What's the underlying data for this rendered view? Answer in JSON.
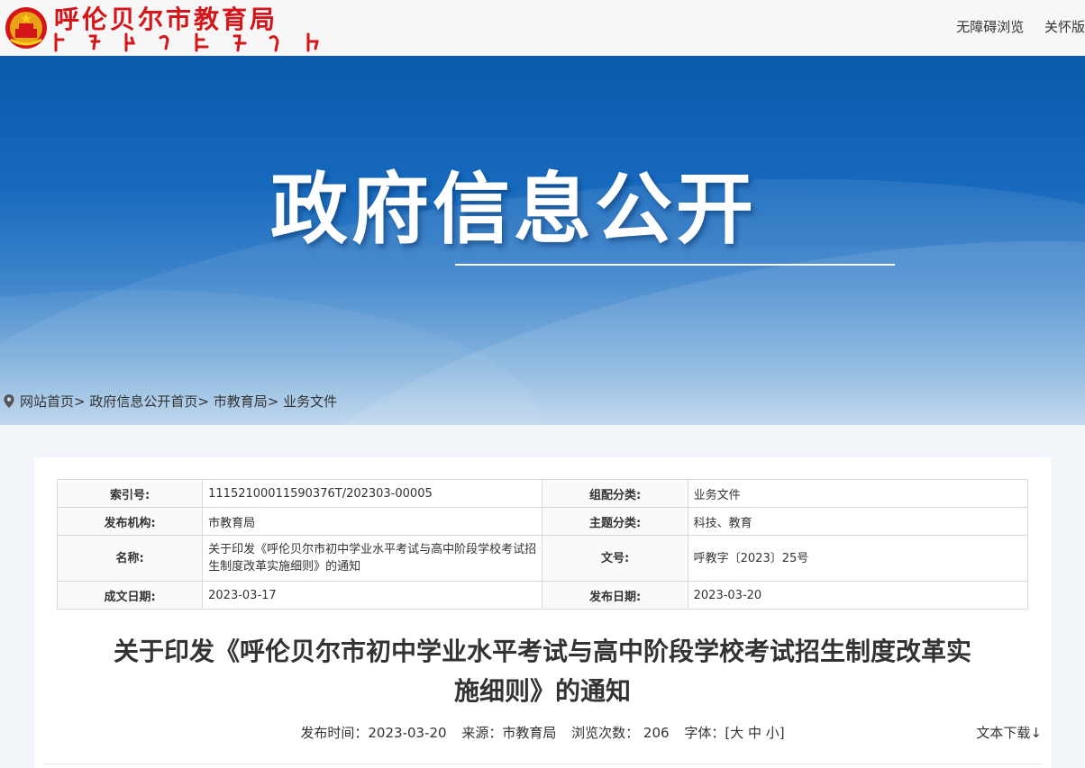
{
  "header": {
    "site_title": "呼伦贝尔市教育局",
    "links": [
      "无障碍浏览",
      "关怀版"
    ]
  },
  "banner": {
    "title": "政府信息公开"
  },
  "breadcrumb": {
    "items": [
      "网站首页",
      "政府信息公开首页",
      "市教育局",
      "业务文件"
    ],
    "separators": [
      ">",
      " >",
      ">"
    ]
  },
  "meta": {
    "index_label": "索引号:",
    "index_value": "11152100011590376T/202303-00005",
    "category_label": "组配分类:",
    "category_value": "业务文件",
    "org_label": "发布机构:",
    "org_value": "市教育局",
    "topic_label": "主题分类:",
    "topic_value": "科技、教育",
    "name_label": "名称:",
    "name_value": "关于印发《呼伦贝尔市初中学业水平考试与高中阶段学校考试招生制度改革实施细则》的通知",
    "docno_label": "文号:",
    "docno_value": "呼教字〔2023〕25号",
    "created_label": "成文日期:",
    "created_value": "2023-03-17",
    "published_label": "发布日期:",
    "published_value": "2023-03-20"
  },
  "document": {
    "title_line1": "关于印发《呼伦贝尔市初中学业水平考试与高中阶段学校考试招生制度改革实",
    "title_line2": "施细则》的通知",
    "publish_time": "发布时间：2023-03-20",
    "source": "来源：市教育局",
    "views": "浏览次数：  206",
    "font_label": "字体：",
    "font_sizes": "[大 中 小]",
    "download": "文本下载↓"
  },
  "colors": {
    "brand_red": "#d4161b",
    "banner_blue": "#0a5aad"
  }
}
